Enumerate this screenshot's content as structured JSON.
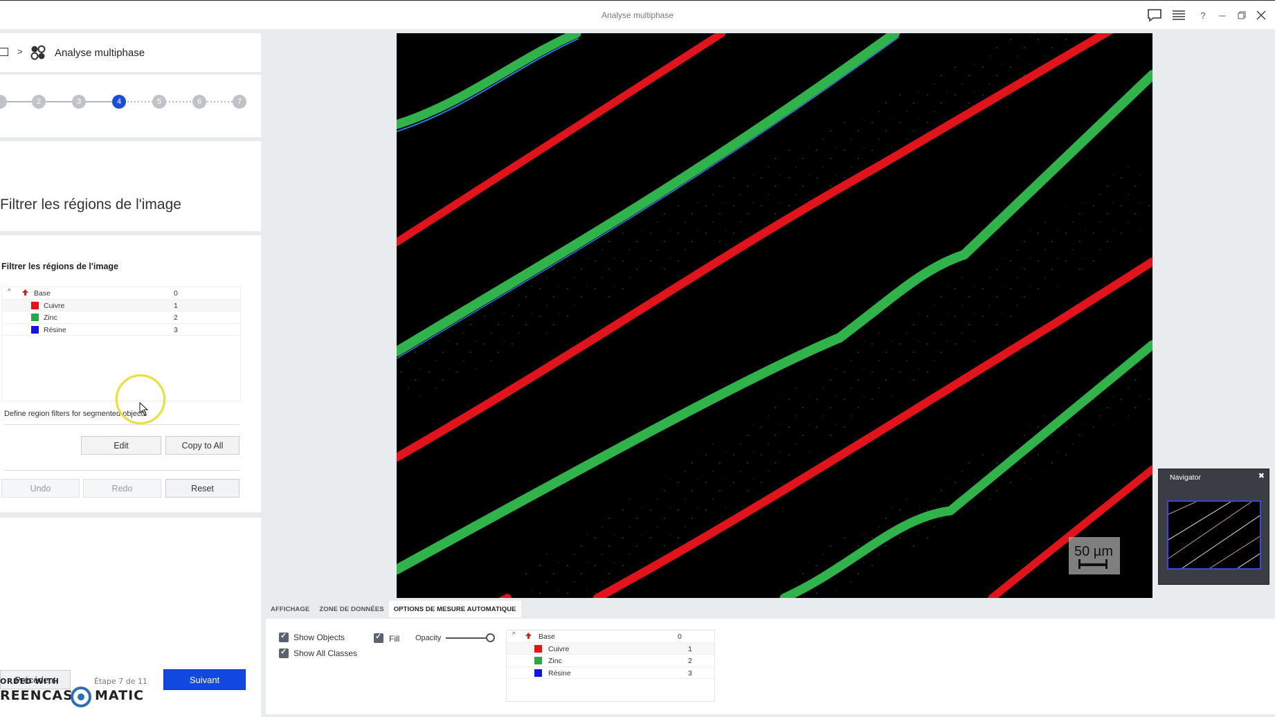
{
  "window": {
    "title": "Analyse multiphase"
  },
  "breadcrumb": {
    "separator": ">",
    "label": "Analyse multiphase"
  },
  "stepper": {
    "steps": [
      "2",
      "3",
      "4",
      "5",
      "6",
      "7"
    ],
    "active": "4"
  },
  "page": {
    "heading": "Filtrer les régions de l'image"
  },
  "filters": {
    "subheading": "Filtrer les régions de l'image",
    "define_text": "Define region filters for segmented objects",
    "edit_label": "Edit",
    "copy_label": "Copy to All",
    "undo_label": "Undo",
    "redo_label": "Redo",
    "reset_label": "Reset"
  },
  "classes": {
    "base": {
      "name": "Base",
      "value": "0"
    },
    "items": [
      {
        "name": "Cuivre",
        "value": "1",
        "color": "#e41414"
      },
      {
        "name": "Zinc",
        "value": "2",
        "color": "#28a745"
      },
      {
        "name": "Résine",
        "value": "3",
        "color": "#1414e6"
      }
    ]
  },
  "navigation": {
    "prev_label": "Précédent",
    "next_label": "Suivant",
    "step_text": "Étape 7 de 11"
  },
  "watermark": {
    "line1": "ORDED WITH",
    "line2a": "REENCAST",
    "line2b": "MATIC"
  },
  "image": {
    "scale_label": "50 µm"
  },
  "navigator": {
    "title": "Navigator"
  },
  "bottom_tabs": [
    {
      "label": "AFFICHAGE",
      "active": false
    },
    {
      "label": "ZONE DE DONNÉES",
      "active": false
    },
    {
      "label": "OPTIONS DE MESURE AUTOMATIQUE",
      "active": true
    }
  ],
  "display_options": {
    "show_objects": "Show Objects",
    "show_all_classes": "Show All Classes",
    "fill": "Fill",
    "opacity": "Opacity",
    "opacity_value": 1.0
  }
}
